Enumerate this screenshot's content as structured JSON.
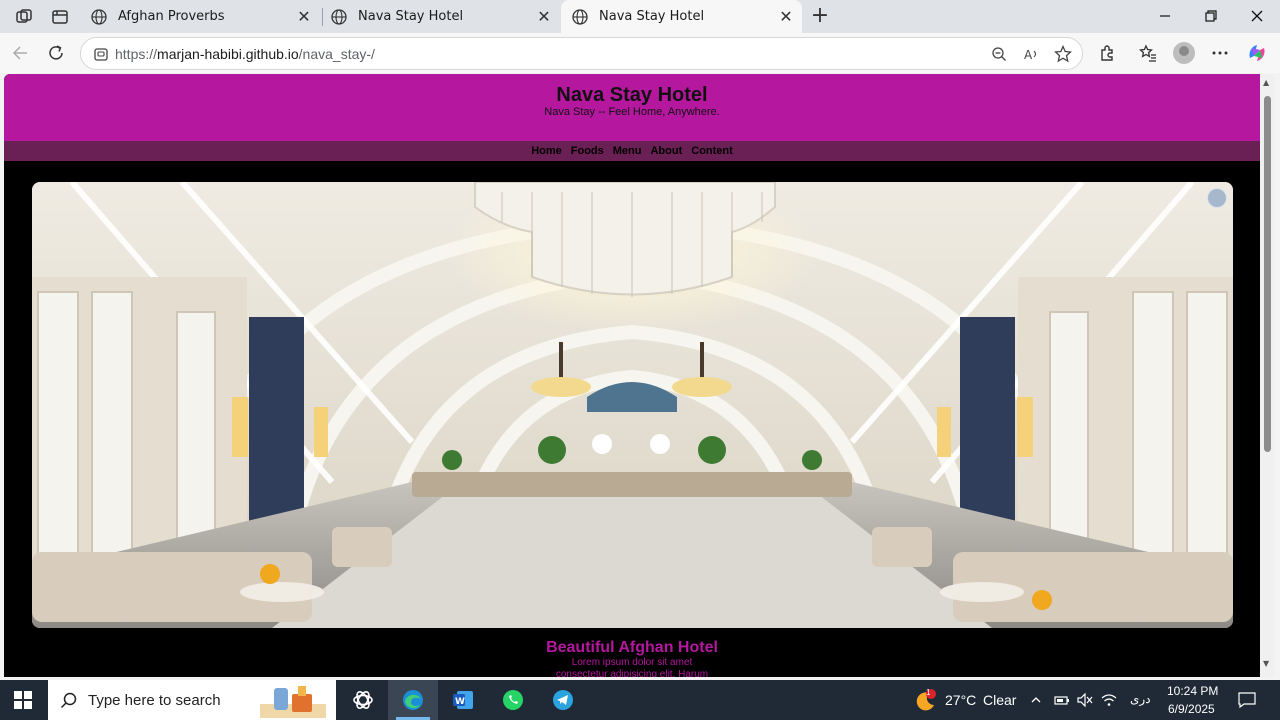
{
  "browser": {
    "tabs": [
      {
        "label": "Afghan Proverbs",
        "active": false
      },
      {
        "label": "Nava Stay Hotel",
        "active": false
      },
      {
        "label": "Nava Stay Hotel",
        "active": true
      }
    ],
    "url_prefix": "https://",
    "url_host": "marjan-habibi.github.io",
    "url_path": "/nava_stay-/",
    "new_tab_symbol": "+",
    "close_symbol": "✕"
  },
  "site": {
    "title": "Nava Stay Hotel",
    "tagline": "Nava Stay -- Feel Home, Anywhere.",
    "nav": [
      "Home",
      "Foods",
      "Menu",
      "About",
      "Content"
    ],
    "hero_alt": "hotel lobby with chandelier",
    "caption_title": "Beautiful Afghan Hotel",
    "caption_line1": "Lorem ipsum dolor sit amet",
    "caption_line2": "consectetur adipisicing elit. Harum",
    "colors": {
      "header": "#b5179e",
      "nav": "#6a1f55",
      "body": "#000000",
      "accent_text": "#b5179e"
    }
  },
  "taskbar": {
    "search_placeholder": "Type here to search",
    "weather_temp": "27°C",
    "weather_desc": "Clear",
    "weather_badge": "1",
    "language": "دری",
    "time": "10:24 PM",
    "date": "6/9/2025",
    "apps": [
      "chatgpt-icon",
      "edge-icon",
      "word-icon",
      "whatsapp-icon",
      "telegram-icon"
    ]
  }
}
